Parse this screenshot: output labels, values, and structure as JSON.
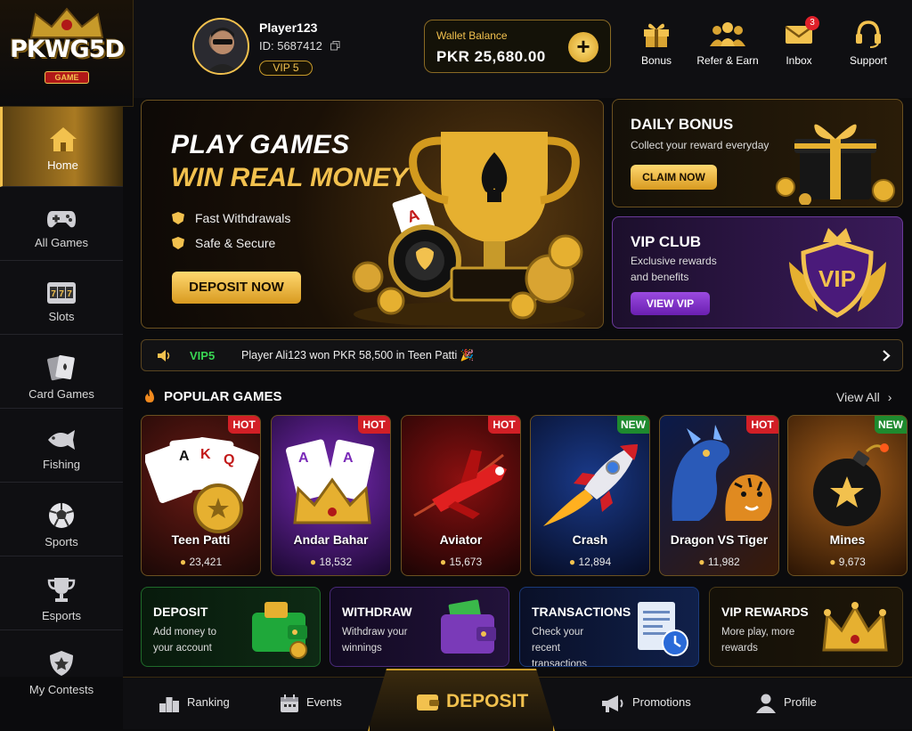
{
  "logo": {
    "text": "PKWG5D",
    "sub": "GAME"
  },
  "user": {
    "name": "Player123",
    "id": "ID: 5687412",
    "vip": "VIP 5"
  },
  "wallet": {
    "label": "Wallet Balance",
    "value": "PKR  25,680.00",
    "add": "+"
  },
  "header_icons": [
    {
      "label": "Bonus",
      "icon": "gift-icon"
    },
    {
      "label": "Refer & Earn",
      "icon": "users-icon"
    },
    {
      "label": "Inbox",
      "icon": "mail-icon",
      "badge": "3"
    },
    {
      "label": "Support",
      "icon": "headset-icon"
    }
  ],
  "sidebar": {
    "items": [
      {
        "label": "Home",
        "icon": "home-icon"
      },
      {
        "label": "All Games",
        "icon": "gamepad-icon"
      },
      {
        "label": "Slots",
        "icon": "slot-machine-icon"
      },
      {
        "label": "Card Games",
        "icon": "cards-icon"
      },
      {
        "label": "Fishing",
        "icon": "fish-icon"
      },
      {
        "label": "Sports",
        "icon": "ball-icon"
      },
      {
        "label": "Esports",
        "icon": "trophy-icon"
      },
      {
        "label": "My Contests",
        "icon": "shield-star-icon"
      }
    ]
  },
  "hero": {
    "title1": "PLAY GAMES",
    "title2": "WIN REAL MONEY",
    "features": [
      "Fast Withdrawals",
      "Safe & Secure"
    ],
    "button": "DEPOSIT NOW"
  },
  "daily": {
    "title": "DAILY BONUS",
    "desc": "Collect your reward everyday",
    "button": "CLAIM NOW"
  },
  "vipclub": {
    "title": "VIP CLUB",
    "desc1": "Exclusive rewards",
    "desc2": "and benefits",
    "button": "VIEW VIP",
    "emblem": "VIP"
  },
  "ticker": {
    "tag": "VIP5",
    "text": "Player Ali123 won PKR 58,500 in Teen Patti 🎉"
  },
  "popular": {
    "title": "POPULAR GAMES",
    "view_all": "View All",
    "games": [
      {
        "name": "Teen Patti",
        "players": "23,421",
        "tag": "HOT"
      },
      {
        "name": "Andar Bahar",
        "players": "18,532",
        "tag": "HOT"
      },
      {
        "name": "Aviator",
        "players": "15,673",
        "tag": "HOT"
      },
      {
        "name": "Crash",
        "players": "12,894",
        "tag": "NEW"
      },
      {
        "name": "Dragon VS Tiger",
        "players": "11,982",
        "tag": "HOT"
      },
      {
        "name": "Mines",
        "players": "9,673",
        "tag": "NEW"
      }
    ]
  },
  "quick": [
    {
      "title": "DEPOSIT",
      "desc": "Add money to your account"
    },
    {
      "title": "WITHDRAW",
      "desc": "Withdraw your winnings"
    },
    {
      "title": "TRANSACTIONS",
      "desc": "Check your recent transactions"
    },
    {
      "title": "VIP REWARDS",
      "desc": "More play, more rewards"
    }
  ],
  "bottom": {
    "items": [
      "Ranking",
      "Events",
      "DEPOSIT",
      "Promotions",
      "Profile"
    ]
  },
  "colors": {
    "gold": "#f2c14e",
    "hot": "#d21f26",
    "new": "#1e8a2e",
    "bg": "#0b0b0d"
  }
}
